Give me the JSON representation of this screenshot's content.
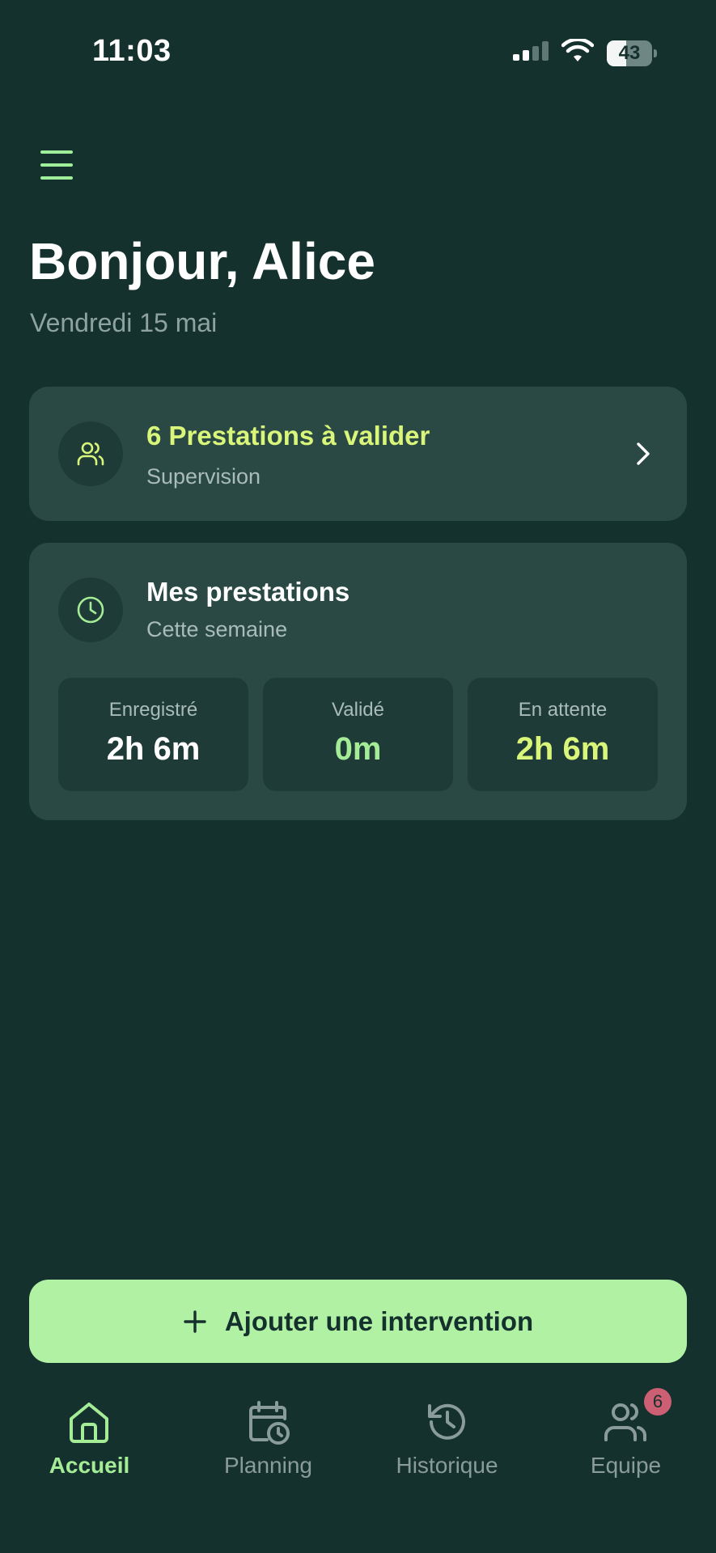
{
  "status_bar": {
    "time": "11:03",
    "battery": 43
  },
  "header": {
    "greeting": "Bonjour, Alice",
    "date": "Vendredi 15 mai"
  },
  "validate_card": {
    "title": "6 Prestations à valider",
    "subtitle": "Supervision",
    "icon": "users-icon"
  },
  "my_services": {
    "title": "Mes prestations",
    "subtitle": "Cette semaine",
    "icon": "clock-icon",
    "stats": [
      {
        "label": "Enregistré",
        "value": "2h 6m",
        "color": "#ffffff"
      },
      {
        "label": "Validé",
        "value": "0m",
        "color": "#a5ec97"
      },
      {
        "label": "En attente",
        "value": "2h 6m",
        "color": "#d9f57a"
      }
    ]
  },
  "add_button": {
    "label": "Ajouter une intervention",
    "icon": "plus-icon"
  },
  "tabs": [
    {
      "label": "Accueil",
      "icon": "home-icon",
      "active": true
    },
    {
      "label": "Planning",
      "icon": "calendar-clock-icon",
      "active": false
    },
    {
      "label": "Historique",
      "icon": "history-icon",
      "active": false
    },
    {
      "label": "Equipe",
      "icon": "team-icon",
      "active": false,
      "badge": "6"
    }
  ],
  "colors": {
    "background": "#15312e",
    "card": "#2a4945",
    "accent": "#b0f1a4",
    "highlight": "#d9f57a",
    "badge": "#cc5f73"
  }
}
